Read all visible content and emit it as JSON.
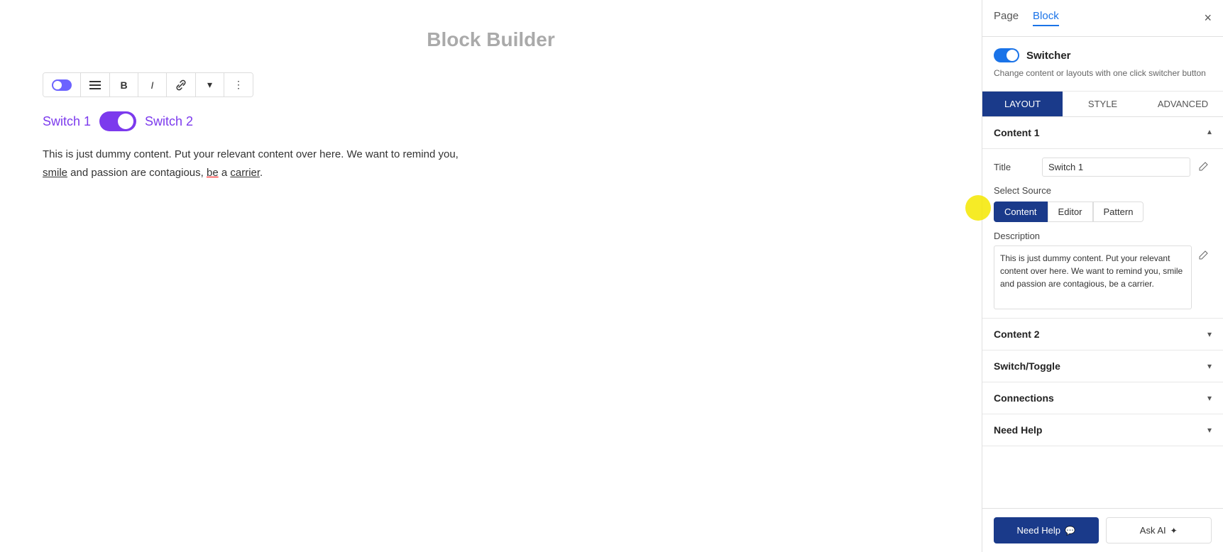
{
  "page": {
    "title": "Block Builder"
  },
  "toolbar": {
    "buttons": [
      {
        "id": "toggle",
        "label": "toggle"
      },
      {
        "id": "align",
        "label": "≡"
      },
      {
        "id": "bold",
        "label": "B"
      },
      {
        "id": "italic",
        "label": "I"
      },
      {
        "id": "link",
        "label": "⇄"
      },
      {
        "id": "dropdown",
        "label": "▾"
      },
      {
        "id": "more",
        "label": "⋮"
      }
    ]
  },
  "switcher": {
    "label1": "Switch 1",
    "label2": "Switch 2"
  },
  "content": {
    "text": "This is just dummy content. Put your relevant content over here. We want to remind you, smile and passion are contagious, be a carrier."
  },
  "right_panel": {
    "tabs": [
      {
        "id": "page",
        "label": "Page"
      },
      {
        "id": "block",
        "label": "Block",
        "active": true
      }
    ],
    "close_label": "×",
    "switcher": {
      "title": "Switcher",
      "description": "Change content or layouts with one click switcher button"
    },
    "layout_tabs": [
      {
        "id": "layout",
        "label": "LAYOUT",
        "active": true
      },
      {
        "id": "style",
        "label": "STYLE"
      },
      {
        "id": "advanced",
        "label": "ADVANCED"
      }
    ],
    "content1": {
      "title": "Content 1",
      "title_field_label": "Title",
      "title_field_value": "Switch 1",
      "select_source_label": "Select Source",
      "source_buttons": [
        {
          "id": "content",
          "label": "Content",
          "active": true
        },
        {
          "id": "editor",
          "label": "Editor"
        },
        {
          "id": "pattern",
          "label": "Pattern"
        }
      ],
      "description_label": "Description",
      "description_value": "This is just dummy content. Put your relevant content over here. We want to remind you, smile and passion are contagious, be a carrier."
    },
    "content2": {
      "title": "Content 2",
      "collapsed": true
    },
    "switch_toggle": {
      "title": "Switch/Toggle",
      "collapsed": true
    },
    "connections": {
      "title": "Connections",
      "collapsed": true
    },
    "need_help": {
      "title": "Need Help",
      "collapsed": true
    },
    "bottom": {
      "need_help_btn": "Need Help",
      "ask_ai_btn": "Ask AI"
    }
  }
}
